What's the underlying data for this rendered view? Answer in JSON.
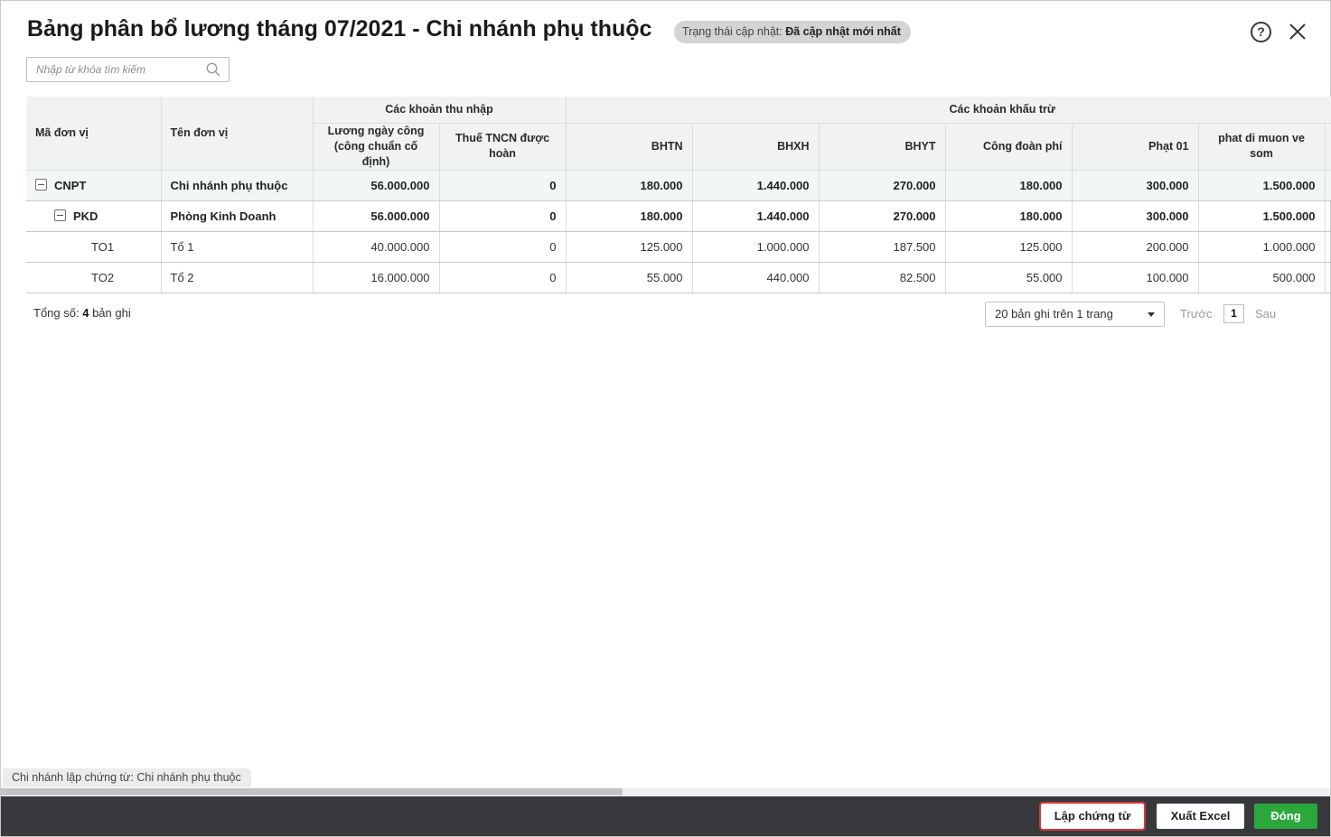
{
  "header": {
    "title": "Bảng phân bổ lương tháng 07/2021 - Chi nhánh phụ thuộc",
    "status_label": "Trạng thái cập nhật:",
    "status_value": "Đã cập nhật mới nhất",
    "help_glyph": "?"
  },
  "search": {
    "placeholder": "Nhập từ khóa tìm kiếm",
    "value": ""
  },
  "table": {
    "col_code": "Mã đơn vị",
    "col_name": "Tên đơn vị",
    "group_income": "Các khoản thu nhập",
    "group_deduction": "Các khoản khấu trừ",
    "col_salary": "Lương ngày công (công chuẩn cố định)",
    "col_tax_refund": "Thuế TNCN được hoàn",
    "col_bhtn": "BHTN",
    "col_bhxh": "BHXH",
    "col_bhyt": "BHYT",
    "col_union_fee": "Công đoàn phí",
    "col_fine01": "Phạt 01",
    "col_late_early": "phat di muon ve som",
    "rows": [
      {
        "code": "CNPT",
        "name": "Chi nhánh phụ thuộc",
        "salary": "56.000.000",
        "tax_refund": "0",
        "bhtn": "180.000",
        "bhxh": "1.440.000",
        "bhyt": "270.000",
        "union_fee": "180.000",
        "fine01": "300.000",
        "late_early": "1.500.000"
      },
      {
        "code": "PKD",
        "name": "Phòng Kinh Doanh",
        "salary": "56.000.000",
        "tax_refund": "0",
        "bhtn": "180.000",
        "bhxh": "1.440.000",
        "bhyt": "270.000",
        "union_fee": "180.000",
        "fine01": "300.000",
        "late_early": "1.500.000"
      },
      {
        "code": "TO1",
        "name": "Tổ 1",
        "salary": "40.000.000",
        "tax_refund": "0",
        "bhtn": "125.000",
        "bhxh": "1.000.000",
        "bhyt": "187.500",
        "union_fee": "125.000",
        "fine01": "200.000",
        "late_early": "1.000.000"
      },
      {
        "code": "TO2",
        "name": "Tổ 2",
        "salary": "16.000.000",
        "tax_refund": "0",
        "bhtn": "55.000",
        "bhxh": "440.000",
        "bhyt": "82.500",
        "union_fee": "55.000",
        "fine01": "100.000",
        "late_early": "500.000"
      }
    ]
  },
  "footer": {
    "total_label": "Tổng số:",
    "total_count": "4",
    "total_suffix": "bản ghi",
    "page_size": "20 bản ghi trên 1 trang",
    "prev": "Trước",
    "page": "1",
    "next": "Sau"
  },
  "bottom": {
    "branch_tag": "Chi nhánh lập chứng từ: Chi nhánh phụ thuộc",
    "btn_create_voucher": "Lập chứng từ",
    "btn_export_excel": "Xuất Excel",
    "btn_close": "Đóng"
  },
  "colors": {
    "close_button": "#2aa83c",
    "action_bar": "#38393d",
    "highlight_border": "#d9363a",
    "header_bg": "#f1f2f4"
  }
}
